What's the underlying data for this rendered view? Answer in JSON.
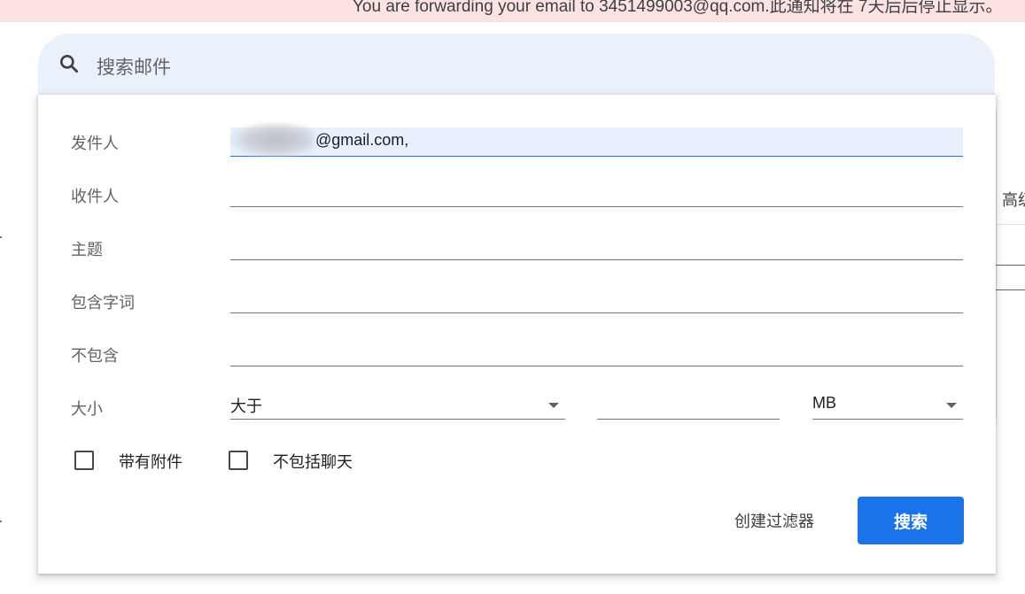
{
  "banner": {
    "text": "You are forwarding your email to 3451499003@qq.com.此通知将在 7天后后停止显示。"
  },
  "search": {
    "placeholder": "搜索邮件",
    "icon": "search-icon"
  },
  "background": {
    "right_text": "高级"
  },
  "advanced_search": {
    "from_label": "发件人",
    "from_value": "@gmail.com,",
    "to_label": "收件人",
    "to_value": "",
    "subject_label": "主题",
    "subject_value": "",
    "has_words_label": "包含字词",
    "has_words_value": "",
    "doesnt_have_label": "不包含",
    "doesnt_have_value": "",
    "size_label": "大小",
    "size_operator": "大于",
    "size_value": "",
    "size_unit": "MB",
    "has_attachment_label": "带有附件",
    "has_attachment_checked": false,
    "exclude_chats_label": "不包括聊天",
    "exclude_chats_checked": false,
    "create_filter_label": "创建过滤器",
    "search_button_label": "搜索"
  },
  "colors": {
    "accent": "#1a73e8",
    "banner_bg": "#fde2e2",
    "search_bg": "#eaf1fb"
  }
}
